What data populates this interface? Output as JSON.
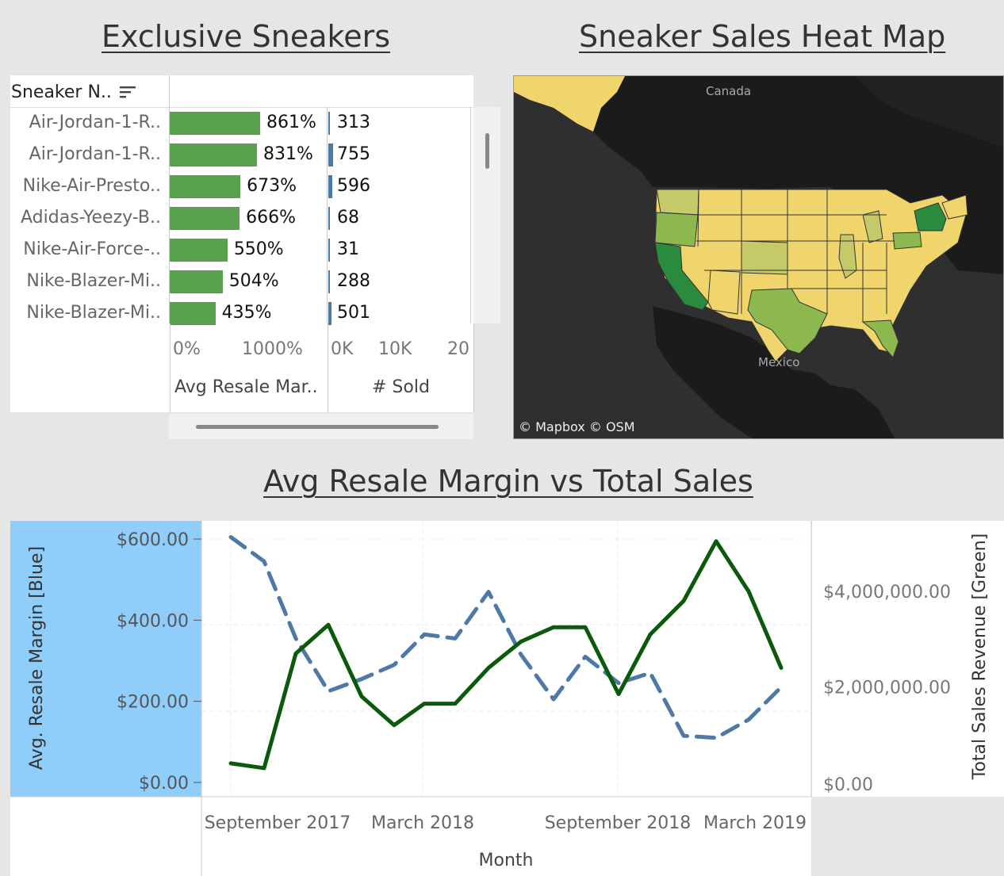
{
  "dashboard": {
    "title_exclusive": "Exclusive Sneakers",
    "title_map": "Sneaker Sales Heat Map",
    "title_line": "Avg Resale Margin vs Total Sales"
  },
  "table": {
    "header_label": "Sneaker N..",
    "sort_icon": "sort-descending-icon",
    "rows": [
      {
        "name": "Air-Jordan-1-R..",
        "margin_pct": "861%",
        "margin_value": 861,
        "sold": "313",
        "sold_value": 313
      },
      {
        "name": "Air-Jordan-1-R..",
        "margin_pct": "831%",
        "margin_value": 831,
        "sold": "755",
        "sold_value": 755
      },
      {
        "name": "Nike-Air-Presto..",
        "margin_pct": "673%",
        "margin_value": 673,
        "sold": "596",
        "sold_value": 596
      },
      {
        "name": "Adidas-Yeezy-B..",
        "margin_pct": "666%",
        "margin_value": 666,
        "sold": "68",
        "sold_value": 68
      },
      {
        "name": "Nike-Air-Force-..",
        "margin_pct": "550%",
        "margin_value": 550,
        "sold": "31",
        "sold_value": 31
      },
      {
        "name": "Nike-Blazer-Mi..",
        "margin_pct": "504%",
        "margin_value": 504,
        "sold": "288",
        "sold_value": 288
      },
      {
        "name": "Nike-Blazer-Mi..",
        "margin_pct": "435%",
        "margin_value": 435,
        "sold": "501",
        "sold_value": 501
      }
    ],
    "margin_axis": {
      "ticks": [
        "0%",
        "1000%"
      ],
      "title": "Avg Resale Mar..",
      "max": 1000
    },
    "sold_axis": {
      "ticks": [
        "0K",
        "10K",
        "20"
      ],
      "title": "# Sold",
      "max": 10000
    },
    "colors": {
      "margin_bar": "#59a14f",
      "sold_bar": "#4e79a7"
    }
  },
  "map": {
    "labels": {
      "canada": "Canada",
      "mexico": "Mexico"
    },
    "attribution": "© Mapbox © OSM",
    "colors": {
      "land": "#1b1b1b",
      "water": "#2f2f2f",
      "low": "#f0d46c",
      "mid": "#c6c967",
      "high": "#8cb84f",
      "top": "#2a8a3e"
    }
  },
  "chart_data": {
    "type": "line",
    "x": [
      "2017-08",
      "2017-09",
      "2017-10",
      "2017-11",
      "2017-12",
      "2018-01",
      "2018-02",
      "2018-03",
      "2018-04",
      "2018-05",
      "2018-06",
      "2018-07",
      "2018-08",
      "2018-09",
      "2018-10",
      "2018-11",
      "2018-12",
      "2019-01",
      "2019-02",
      "2019-03",
      "2019-04"
    ],
    "x_ticks": [
      "September 2017",
      "March 2018",
      "September 2018",
      "March 2019"
    ],
    "xlabel": "Month",
    "y_left": {
      "label": "Avg. Resale Margin [Blue]",
      "ticks": [
        "$600.00",
        "$400.00",
        "$200.00",
        "$0.00"
      ],
      "ylim": [
        0,
        620
      ]
    },
    "y_right": {
      "label": "Total Sales Revenue  [Green]",
      "ticks": [
        "$4,000,000.00",
        "$2,000,000.00",
        "$0.00"
      ],
      "ylim": [
        0,
        5100000
      ]
    },
    "series": [
      {
        "axis": "left",
        "color": "#4e79a7",
        "dash": true,
        "values": [
          605,
          545,
          355,
          225,
          255,
          290,
          365,
          355,
          470,
          315,
          205,
          310,
          245,
          270,
          115,
          110,
          155,
          235
        ]
      },
      {
        "axis": "right",
        "color": "#0b5a0b",
        "dash": false,
        "values": [
          400000,
          300000,
          2700000,
          3300000,
          1800000,
          1200000,
          1650000,
          1650000,
          2400000,
          2950000,
          3250000,
          3250000,
          1850000,
          3100000,
          3800000,
          5050000,
          4000000,
          2400000
        ]
      }
    ],
    "series_x_index": [
      0,
      1,
      2,
      3,
      4,
      5,
      6,
      7,
      8,
      9,
      10,
      11,
      12,
      13,
      14,
      15,
      16,
      17
    ],
    "grid": true
  }
}
